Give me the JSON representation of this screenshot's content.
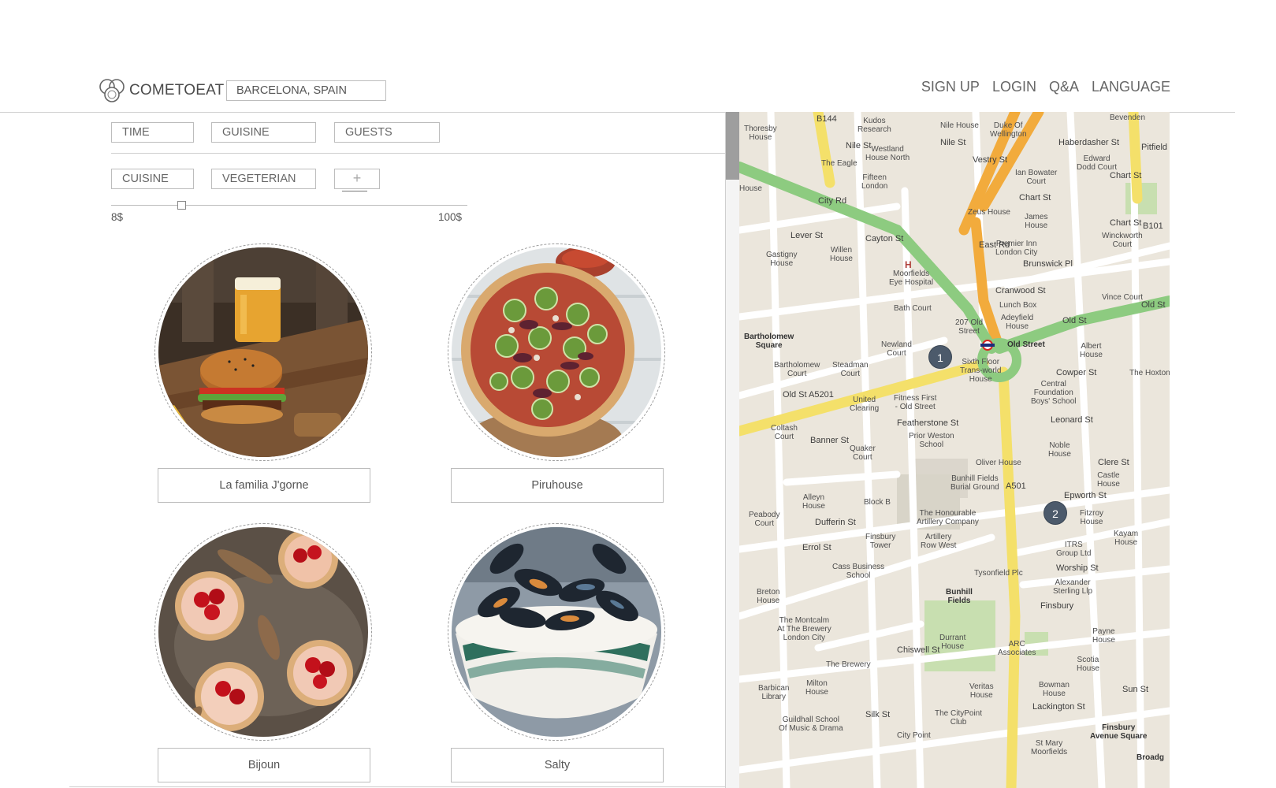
{
  "header": {
    "brand": "COMETOEAT",
    "location": "BARCELONA, SPAIN",
    "nav": [
      "SIGN UP",
      "LOGIN",
      "Q&A",
      "LANGUAGE"
    ]
  },
  "filters": {
    "time": "TIME",
    "guisine": "GUISINE",
    "guests": "GUESTS",
    "cuisine": "CUISINE",
    "vegeterian": "VEGETERIAN",
    "add": "+"
  },
  "price": {
    "min": "8$",
    "max": "100$",
    "value_fraction": 0.2
  },
  "restaurants": [
    {
      "name": "La familia J'gorne",
      "image": "burger-with-beer"
    },
    {
      "name": "Piruhouse",
      "image": "pizza"
    },
    {
      "name": "Bijoun",
      "image": "cherry-tarts"
    },
    {
      "name": "Salty",
      "image": "mussels-bowl"
    }
  ],
  "map": {
    "pins": [
      "1",
      "2"
    ],
    "labels": {
      "kudos": "Kudos\nResearch",
      "nile_house": "Nile House",
      "duke": "Duke Of\nWellington",
      "bevenden": "Bevenden",
      "thoresby": "Thoresby\nHouse",
      "nile_st": "Nile St",
      "nile_st2": "Nile St",
      "westland": "Westland\nHouse North",
      "haberdasher": "Haberdasher St",
      "edward": "Edward\nDodd Court",
      "eagle": "The Eagle",
      "fifteen": "Fifteen\nLondon",
      "ian": "Ian Bowater\nCourt",
      "leslandst": "Chart St",
      "house": "House",
      "city_rd": "City Rd",
      "zeus": "Zeus House",
      "james": "James\nHouse",
      "chart": "Chart St",
      "winck": "Winckworth\nCourt",
      "lever": "Lever St",
      "cayton": "Cayton St",
      "gastigny": "Gastigny\nHouse",
      "willen": "Willen\nHouse",
      "premier": "Premier Inn\nLondon City",
      "brunswick": "Brunswick Pl",
      "moorfields": "Moorfields\nEye Hospital",
      "cranwood": "Cranwood St",
      "lunch": "Lunch Box",
      "vince": "Vince Court",
      "old_st_top": "Old St",
      "bath": "Bath Court",
      "adeyfield": "Adeyfield\nHouse",
      "old_st_r": "Old St",
      "bartholomew_sq": "Bartholomew\nSquare",
      "old207": "207 Old\nStreet",
      "newland": "Newland\nCourt",
      "old_street": "Old Street",
      "albert": "Albert\nHouse",
      "barth_court": "Bartholomew\nCourt",
      "steadman": "Steadman\nCourt",
      "sixth": "Sixth Floor\nTrans-world\nHouse",
      "cowper": "Cowper St",
      "hoxton": "The Hoxton",
      "central": "Central\nFoundation\nBoys' School",
      "old_st_a5201": "Old St   A5201",
      "united": "United\nClearing",
      "fitness": "Fitness First\n- Old Street",
      "featherstone": "Featherstone St",
      "leonard": "Leonard St",
      "coltash": "Coltash\nCourt",
      "prior": "Prior Weston\nSchool",
      "noble": "Noble\nHouse",
      "banner": "Banner St",
      "quaker": "Quaker\nCourt",
      "oliver": "Oliver House",
      "clere": "Clere St",
      "castle": "Castle\nHouse",
      "bunhill_burial": "Bunhill Fields\nBurial Ground",
      "epworth": "Epworth St",
      "alleyn": "Alleyn\nHouse",
      "block_b": "Block B",
      "honourable": "The Honourable\nArtillery Company",
      "fitzroy": "Fitzroy\nHouse",
      "peabody": "Peabody\nCourt",
      "dufferin": "Dufferin St",
      "finsbury_tower": "Finsbury\nTower",
      "artillery": "Artillery\nRow West",
      "itrs": "ITRS\nGroup Ltd",
      "kayam": "Kayam\nHouse",
      "errol": "Errol St",
      "worship": "Worship St",
      "cass": "Cass Business\nSchool",
      "tysonfield": "Tysonfield Plc",
      "alexander": "Alexander\nSterling Llp",
      "breton": "Breton\nHouse",
      "bunhill": "Bunhill\nFields",
      "montcalm": "The Montcalm\nAt The Brewery\nLondon City",
      "finsbury_st": "Finsbury",
      "payne": "Payne\nHouse",
      "durrant": "Durrant\nHouse",
      "arc": "ARC\nAssociates",
      "chiswell": "Chiswell St",
      "brewery": "The Brewery",
      "scotia": "Scotia\nHouse",
      "barbican": "Barbican\nLibrary",
      "milton": "Milton\nHouse",
      "veritas": "Veritas\nHouse",
      "bowman": "Bowman\nHouse",
      "sun_st": "Sun St",
      "guildhall": "Guildhall School\nOf Music & Drama",
      "silk": "Silk St",
      "citypoint_club": "The CityPoint\nClub",
      "lackington": "Lackington St",
      "finsbury_sq": "Finsbury\nAvenue Square",
      "city_point": "City Point",
      "st_mary": "St Mary\nMoorfields",
      "broadg": "Broadg",
      "b144": "B144",
      "b101": "B101",
      "a501": "A501",
      "vestry": "Vestry St",
      "east_rd": "East Rd",
      "pitfield": "Pitfield St"
    }
  },
  "colors": {
    "brand_text": "#4a4a4a",
    "pin": "#4c5a6b",
    "map_bg": "#ebe6dc",
    "road_green": "#8dcb80",
    "road_yellow": "#f7e98a",
    "road_orange": "#f6b34a"
  }
}
